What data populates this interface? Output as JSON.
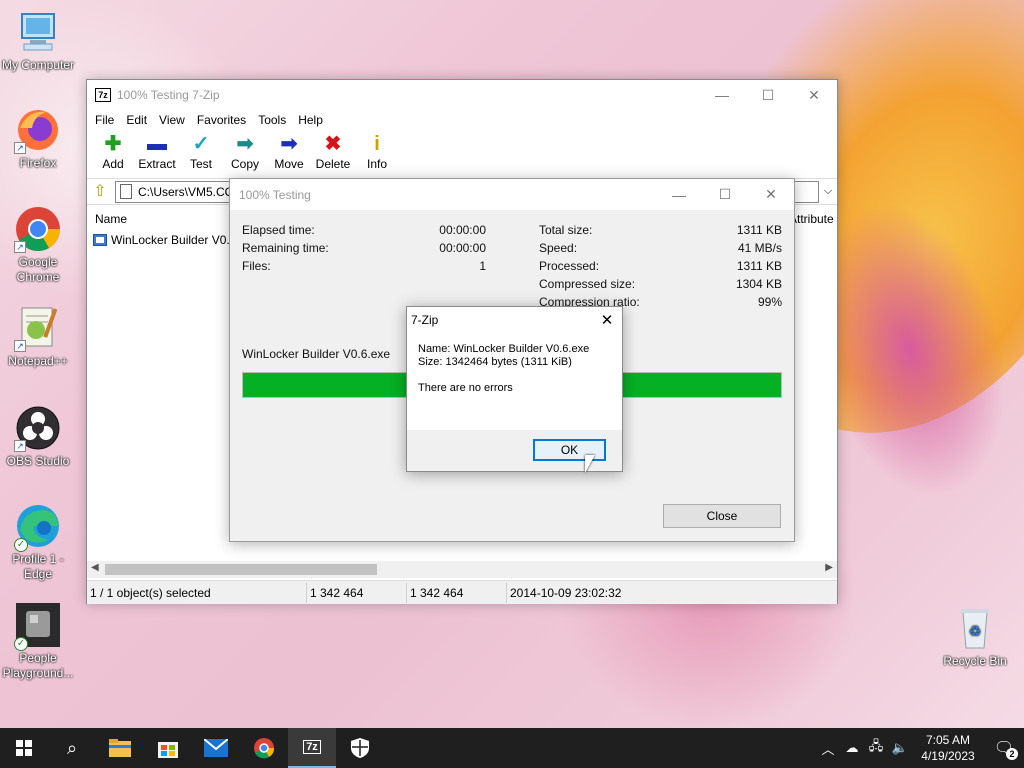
{
  "desktop": {
    "icons": [
      {
        "label": "My Computer"
      },
      {
        "label": "Firefox"
      },
      {
        "label": "Google Chrome"
      },
      {
        "label": "Notepad++"
      },
      {
        "label": "OBS Studio"
      },
      {
        "label": "Profile 1 - Edge"
      },
      {
        "label": "People Playground..."
      },
      {
        "label": "Recycle Bin"
      }
    ]
  },
  "main_window": {
    "title": "100% Testing 7-Zip",
    "app_icon": "7z",
    "menu": [
      "File",
      "Edit",
      "View",
      "Favorites",
      "Tools",
      "Help"
    ],
    "toolbar": [
      {
        "label": "Add",
        "icon": "plus-icon",
        "color": "#1fa01f"
      },
      {
        "label": "Extract",
        "icon": "minus-icon",
        "color": "#1c2fb5"
      },
      {
        "label": "Test",
        "icon": "check-down-icon",
        "color": "#17a9b8"
      },
      {
        "label": "Copy",
        "icon": "arrow-right-icon",
        "color": "#1a8a8a"
      },
      {
        "label": "Move",
        "icon": "arrow-right-icon",
        "color": "#1c2fb5"
      },
      {
        "label": "Delete",
        "icon": "x-icon",
        "color": "#d4131b"
      },
      {
        "label": "Info",
        "icon": "info-icon",
        "color": "#c9a300"
      }
    ],
    "address": "C:\\Users\\VM5.CO",
    "columns": {
      "name": "Name",
      "attributes": "Attribute"
    },
    "files": [
      {
        "name": "WinLocker Builder V0.6"
      }
    ],
    "status": {
      "selected": "1 / 1 object(s) selected",
      "size": "1 342 464",
      "packed": "1 342 464",
      "modified": "2014-10-09 23:02:32"
    }
  },
  "testing_dialog": {
    "title": "100% Testing",
    "left_stats": [
      {
        "label": "Elapsed time:",
        "value": "00:00:00"
      },
      {
        "label": "Remaining time:",
        "value": "00:00:00"
      },
      {
        "label": "Files:",
        "value": "1"
      }
    ],
    "right_stats": [
      {
        "label": "Total size:",
        "value": "1311 KB"
      },
      {
        "label": "Speed:",
        "value": "41 MB/s"
      },
      {
        "label": "Processed:",
        "value": "1311 KB"
      },
      {
        "label": "Compressed size:",
        "value": "1304 KB"
      },
      {
        "label": "Compression ratio:",
        "value": "99%"
      }
    ],
    "current_file": "WinLocker Builder V0.6.exe",
    "progress_percent": 100,
    "close_label": "Close"
  },
  "message_box": {
    "title": "7-Zip",
    "line1": "Name: WinLocker Builder V0.6.exe",
    "line2": "Size: 1342464 bytes (1311 KiB)",
    "line3": "There are no errors",
    "ok_label": "OK"
  },
  "taskbar": {
    "time": "7:05 AM",
    "date": "4/19/2023",
    "notification_count": "2",
    "seven_zip_label": "7z"
  }
}
